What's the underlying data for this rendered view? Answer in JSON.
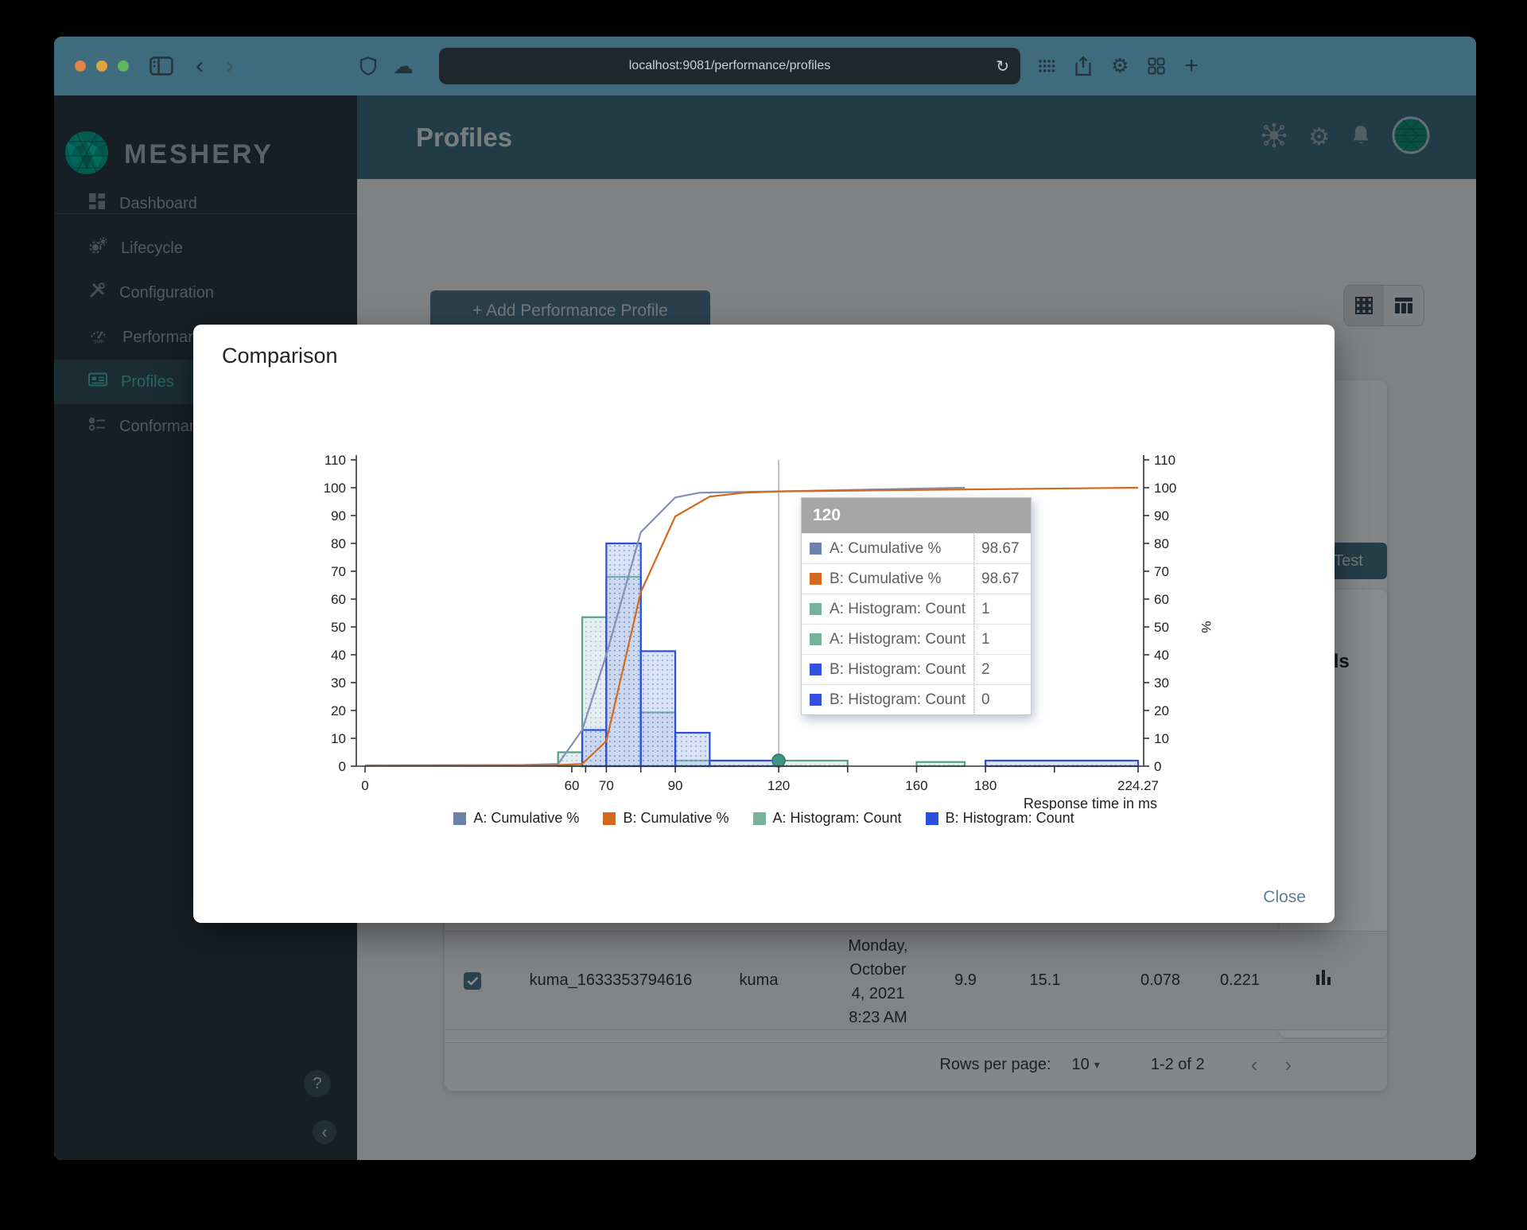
{
  "browser": {
    "url": "localhost:9081/performance/profiles",
    "traffic_lights": [
      "#e08445",
      "#dfa23e",
      "#5cb85f"
    ],
    "refresh_glyph": "↻",
    "gear_glyph": "⚙",
    "plus_glyph": "+",
    "cloud_glyph": "☁",
    "back_glyph": "‹",
    "forward_glyph": "›"
  },
  "sidebar": {
    "brand": "MESHERY",
    "items": [
      {
        "label": "Dashboard",
        "icon": "dashboard-icon",
        "selected": false
      },
      {
        "label": "Lifecycle",
        "icon": "lifecycle-icon",
        "selected": false
      },
      {
        "label": "Configuration",
        "icon": "configuration-icon",
        "selected": false
      },
      {
        "label": "Performance",
        "icon": "performance-icon",
        "icon_text": "smp",
        "selected": false
      },
      {
        "label": "Profiles",
        "icon": "profiles-icon",
        "selected": true
      },
      {
        "label": "Conformance",
        "icon": "conformance-icon",
        "selected": false
      }
    ],
    "help_glyph": "?",
    "collapse_glyph": "‹"
  },
  "header": {
    "title": "Profiles"
  },
  "content": {
    "add_button": {
      "plus": "+",
      "label": "Add Performance Profile"
    },
    "test_button": "Test",
    "details_heading": "Details",
    "back_arrow": "←",
    "row": {
      "name": "kuma_1633353794616",
      "mesh": "kuma",
      "date_lines": [
        "Monday,",
        "October",
        "4, 2021",
        "8:23 AM"
      ],
      "v1": "9.9",
      "v2": "15.1",
      "v3": "0.078",
      "v4": "0.221"
    },
    "pagination": {
      "label": "Rows per page:",
      "value": "10",
      "caret_glyph": "▾",
      "range": "1-2 of 2",
      "prev_glyph": "‹",
      "next_glyph": "›"
    }
  },
  "modal": {
    "title": "Comparison",
    "close_label": "Close"
  },
  "colors": {
    "chrome": "#3e6b7e",
    "app_header": "#396679",
    "sidebar": "#253238",
    "accent_teal": "#45b8b0",
    "series_a_line": "#8191b4",
    "series_b_line": "#d2691e",
    "series_a_hist": "#57a089",
    "series_b_hist": "#2a4ddb"
  },
  "chart_data": {
    "type": "histogram+cumulative-line",
    "xlabel": "Response time in ms",
    "ylabel_right": "%",
    "xlim": [
      0,
      224.27
    ],
    "ylim": [
      0,
      110
    ],
    "y_ticks": [
      0,
      10,
      20,
      30,
      40,
      50,
      60,
      70,
      80,
      90,
      100,
      110
    ],
    "x_ticks_labeled": [
      "0",
      "60",
      "70",
      "90",
      "120",
      "160",
      "180",
      "224.27"
    ],
    "x_ticks_minor": [
      64,
      80,
      140,
      200
    ],
    "series": [
      {
        "name": "A: Cumulative %",
        "type": "line",
        "color": "#8191b4",
        "points": [
          [
            0,
            0.3
          ],
          [
            45,
            0.4
          ],
          [
            56,
            0.8
          ],
          [
            63,
            13
          ],
          [
            70,
            40
          ],
          [
            80,
            84
          ],
          [
            90,
            96.5
          ],
          [
            97,
            98.2
          ],
          [
            120,
            98.67
          ],
          [
            140,
            99.2
          ],
          [
            174,
            100
          ]
        ]
      },
      {
        "name": "B: Cumulative %",
        "type": "line",
        "color": "#d2691e",
        "points": [
          [
            0,
            0.2
          ],
          [
            56,
            0.4
          ],
          [
            63,
            0.8
          ],
          [
            70,
            9
          ],
          [
            80,
            62.5
          ],
          [
            90,
            89.7
          ],
          [
            100,
            96.8
          ],
          [
            110,
            98.2
          ],
          [
            120,
            98.67
          ],
          [
            160,
            99.2
          ],
          [
            200,
            99.7
          ],
          [
            224.27,
            100
          ]
        ]
      },
      {
        "name": "A: Histogram: Count",
        "type": "histogram",
        "color": "#57a089",
        "pattern": "patA",
        "bars": [
          {
            "x1": 56,
            "x2": 63,
            "h": 5
          },
          {
            "x1": 63,
            "x2": 70,
            "h": 53.5
          },
          {
            "x1": 70,
            "x2": 80,
            "h": 68
          },
          {
            "x1": 80,
            "x2": 90,
            "h": 19.3
          },
          {
            "x1": 90,
            "x2": 100,
            "h": 2
          },
          {
            "x1": 120,
            "x2": 140,
            "h": 2
          },
          {
            "x1": 160,
            "x2": 174,
            "h": 1.5
          }
        ]
      },
      {
        "name": "B: Histogram: Count",
        "type": "histogram",
        "color": "#2a4ddb",
        "pattern": "patB",
        "bars": [
          {
            "x1": 63,
            "x2": 70,
            "h": 13
          },
          {
            "x1": 70,
            "x2": 80,
            "h": 80
          },
          {
            "x1": 80,
            "x2": 90,
            "h": 41.3
          },
          {
            "x1": 90,
            "x2": 100,
            "h": 12
          },
          {
            "x1": 100,
            "x2": 120,
            "h": 2
          },
          {
            "x1": 180,
            "x2": 224.27,
            "h": 2
          }
        ]
      }
    ],
    "crosshair": {
      "x": 120,
      "dot_y": 2,
      "line_color": "#b0b0b0",
      "dot_color": "#3f9487"
    },
    "tooltip": {
      "header": "120",
      "rows": [
        {
          "swatch": "#6e81a8",
          "label": "A: Cumulative %",
          "value": "98.67"
        },
        {
          "swatch": "#d2691e",
          "label": "B: Cumulative %",
          "value": "98.67"
        },
        {
          "swatch": "#74b39a",
          "label": "A: Histogram: Count",
          "value": "1"
        },
        {
          "swatch": "#74b39a",
          "label": "A: Histogram: Count",
          "value": "1"
        },
        {
          "swatch": "#3350e0",
          "label": "B: Histogram: Count",
          "value": "2"
        },
        {
          "swatch": "#3350e0",
          "label": "B: Histogram: Count",
          "value": "0"
        }
      ]
    },
    "legend": [
      {
        "label": "A: Cumulative %",
        "color": "#6e81a8"
      },
      {
        "label": "B: Cumulative %",
        "color": "#d2691e"
      },
      {
        "label": "A: Histogram: Count",
        "color": "#74b39a"
      },
      {
        "label": "B: Histogram: Count",
        "color": "#2a50dd"
      }
    ],
    "legend_position": "bottom-center",
    "grid": false
  }
}
